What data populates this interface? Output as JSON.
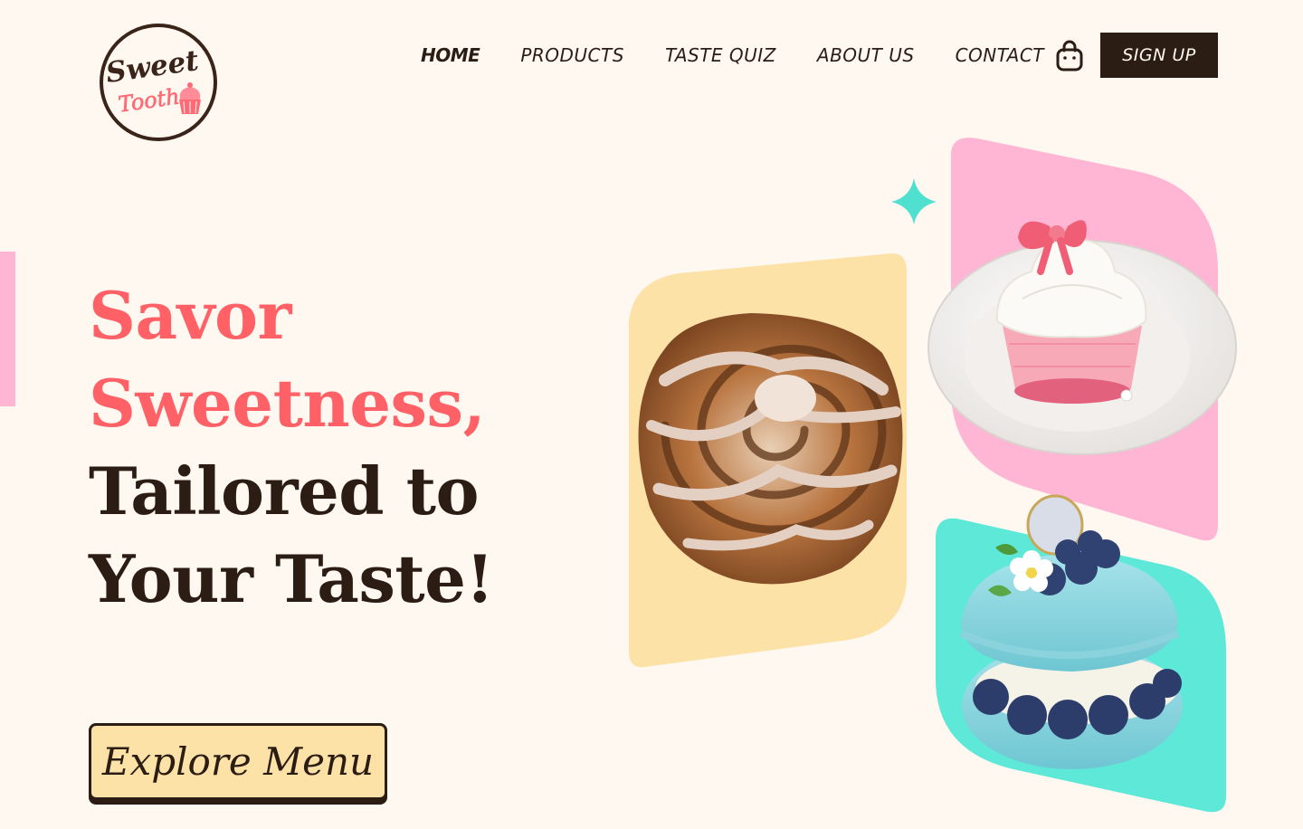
{
  "logo": {
    "line1": "Sweet",
    "line2": "Tooth"
  },
  "nav": [
    {
      "label": "HOME",
      "active": true
    },
    {
      "label": "PRODUCTS"
    },
    {
      "label": "TASTE QUIZ"
    },
    {
      "label": "ABOUT US"
    },
    {
      "label": "CONTACT"
    }
  ],
  "header": {
    "cart_icon": "shopping-bag-icon",
    "signup_label": "SIGN UP"
  },
  "hero": {
    "line1": "Savor",
    "line2": "Sweetness,",
    "line3": "Tailored to",
    "line4": "Your Taste!",
    "cta_label": "Explore Menu"
  },
  "colors": {
    "background": "#fff8f1",
    "accent_pink": "#ff6166",
    "dark": "#2b1d14",
    "card_yellow": "#fde2a8",
    "card_pink": "#ffb5d4",
    "card_teal": "#5ee8d8",
    "sparkle": "#4fe0cf"
  },
  "images": [
    "cinnamon-roll-image",
    "cupcake-image",
    "blue-macaron-image"
  ]
}
